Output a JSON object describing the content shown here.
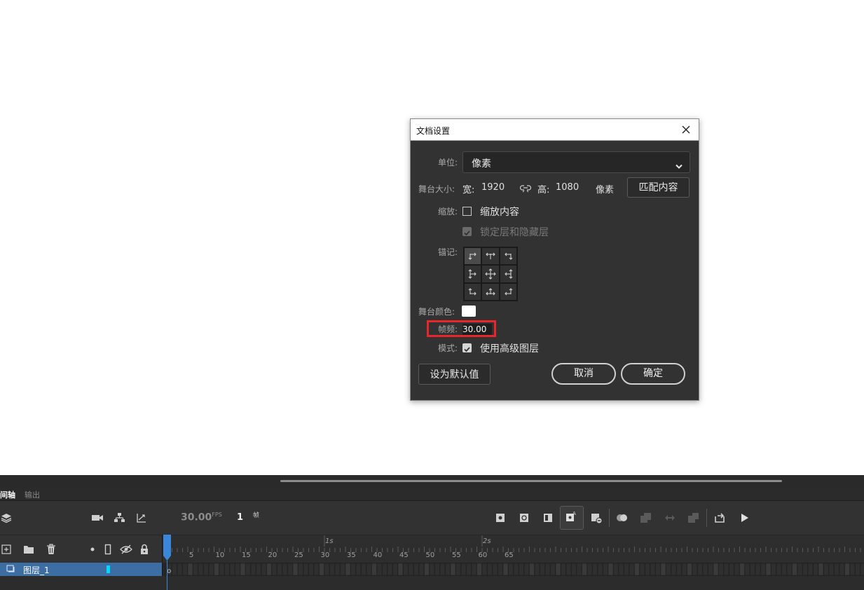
{
  "dialog": {
    "title": "文档设置",
    "unit_label": "单位:",
    "unit_value": "像素",
    "stage_size_label": "舞台大小:",
    "width_label": "宽:",
    "width_value": "1920",
    "height_label": "高:",
    "height_value": "1080",
    "size_unit": "像素",
    "match_content_button": "匹配内容",
    "scale_label": "缩放:",
    "scale_content_option": "缩放内容",
    "scale_content_checked": false,
    "lock_hidden_option": "锁定层和隐藏层",
    "lock_hidden_checked": true,
    "anchor_label": "锚记:",
    "stage_color_label": "舞台颜色:",
    "stage_color": "#ffffff",
    "frame_rate_label": "帧频:",
    "frame_rate_value": "30.00",
    "mode_label": "模式:",
    "advanced_layers_option": "使用高级图层",
    "advanced_layers_checked": true,
    "set_default_button": "设为默认值",
    "cancel_button": "取消",
    "ok_button": "确定",
    "highlight_color": "#e8262b"
  },
  "timeline": {
    "tabs": [
      "间轴",
      "输出"
    ],
    "fps_value": "30.00",
    "fps_suffix": "FPS",
    "current_frame": "1",
    "frame_suffix": "帧",
    "ruler_numbers": [
      "5",
      "10",
      "15",
      "20",
      "25",
      "30",
      "35",
      "40",
      "45",
      "50",
      "55",
      "60",
      "65"
    ],
    "ruler_seconds": [
      "1s",
      "2s"
    ],
    "layer_name": "图层_1",
    "selection_color": "#3d6ea3",
    "layer_color_marker": "#00d8ff"
  }
}
